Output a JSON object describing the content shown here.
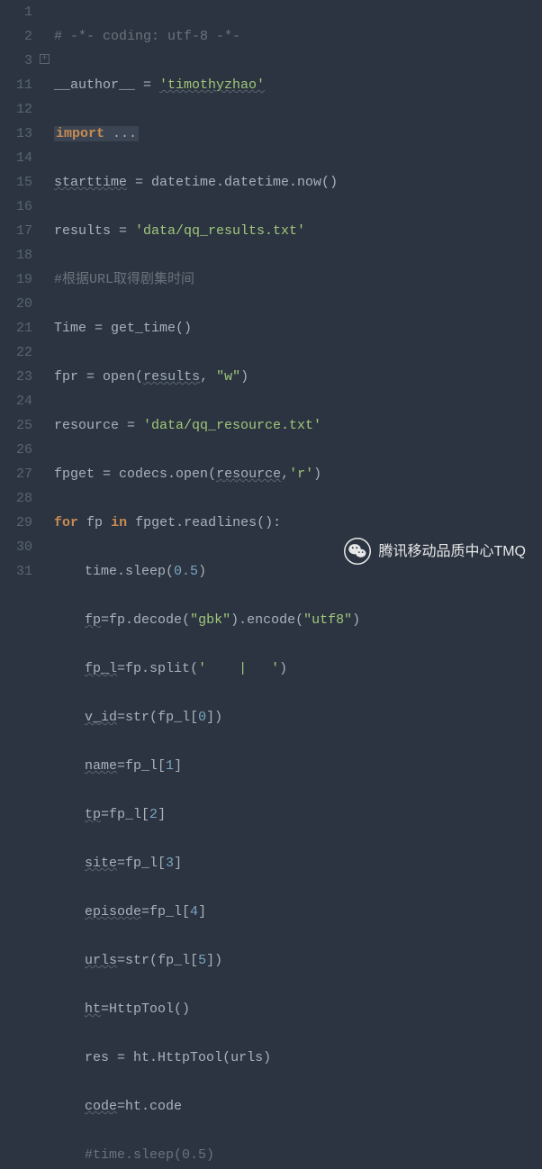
{
  "gutter": [
    "1",
    "2",
    "3",
    "11",
    "12",
    "13",
    "14",
    "15",
    "16",
    "17",
    "18",
    "19",
    "20",
    "21",
    "22",
    "23",
    "24",
    "25",
    "26",
    "27",
    "28",
    "29",
    "30",
    "31"
  ],
  "lines": {
    "l1": {
      "comment": "# -*- coding: utf-8 -*-"
    },
    "l2": {
      "var": "__author__",
      "op": " = ",
      "str": "'timothyzhao'"
    },
    "l3": {
      "kw": "import",
      "fold": " ..."
    },
    "l11": {
      "var": "starttime",
      "op": " = ",
      "expr": "datetime.datetime.now()"
    },
    "l12": {
      "var": "results",
      "op": " = ",
      "str": "'data/qq_results.txt'"
    },
    "l13": {
      "comment": "#根据URL取得剧集时间"
    },
    "l14": {
      "var": "Time",
      "op": " = ",
      "call": "get_time()"
    },
    "l15": {
      "var": "fpr",
      "op": " = ",
      "fn": "open",
      "p": "(",
      "a1": "results",
      "c": ", ",
      "s": "\"w\"",
      "pe": ")"
    },
    "l16": {
      "var": "resource",
      "op": " = ",
      "str": "'data/qq_resource.txt'"
    },
    "l17": {
      "var": "fpget",
      "op": " = ",
      "pre": "codecs.",
      "fn": "open",
      "p": "(",
      "a1": "resource",
      "c": ",",
      "s": "'r'",
      "pe": ")"
    },
    "l18": {
      "kfor": "for",
      "sp1": " ",
      "v": "fp",
      "sp2": " ",
      "kin": "in",
      "sp3": " ",
      "expr": "fpget.readlines():"
    },
    "l19": {
      "pre": "time.",
      "fn": "sleep",
      "p": "(",
      "n": "0.5",
      "pe": ")"
    },
    "l20": {
      "a": "fp",
      "op": "=",
      "b": "fp.",
      "fn1": "decode",
      "p1": "(",
      "s1": "\"gbk\"",
      "pe1": ").",
      "fn2": "encode",
      "p2": "(",
      "s2": "\"utf8\"",
      "pe2": ")"
    },
    "l21": {
      "a": "fp_l",
      "op": "=",
      "b": "fp.",
      "fn": "split",
      "p": "(",
      "s": "'    |   '",
      "pe": ")"
    },
    "l22": {
      "a": "v_id",
      "op": "=",
      "fn": "str",
      "p": "(",
      "b": "fp_l[",
      "n": "0",
      "pe": "])"
    },
    "l23": {
      "a": "name",
      "op": "=",
      "b": "fp_l[",
      "n": "1",
      "pe": "]"
    },
    "l24": {
      "a": "tp",
      "op": "=",
      "b": "fp_l[",
      "n": "2",
      "pe": "]"
    },
    "l25": {
      "a": "site",
      "op": "=",
      "b": "fp_l[",
      "n": "3",
      "pe": "]"
    },
    "l26": {
      "a": "episode",
      "op": "=",
      "b": "fp_l[",
      "n": "4",
      "pe": "]"
    },
    "l27": {
      "a": "urls",
      "op": "=",
      "fn": "str",
      "p": "(",
      "b": "fp_l[",
      "n": "5",
      "pe": "])"
    },
    "l28": {
      "a": "ht",
      "op": "=",
      "fn": "HttpTool",
      "p": "()",
      "pe": ""
    },
    "l29": {
      "a": "res",
      "op": " = ",
      "pre": "ht.",
      "fn": "HttpTool",
      "p": "(",
      "b": "urls",
      "pe": ")"
    },
    "l30": {
      "a": "code",
      "op": "=",
      "b": "ht.code"
    },
    "l31": {
      "comment": "#time.sleep(0.5)"
    }
  },
  "watermark": {
    "text": "腾讯移动品质中心TMQ",
    "icon": "wechat-icon"
  }
}
